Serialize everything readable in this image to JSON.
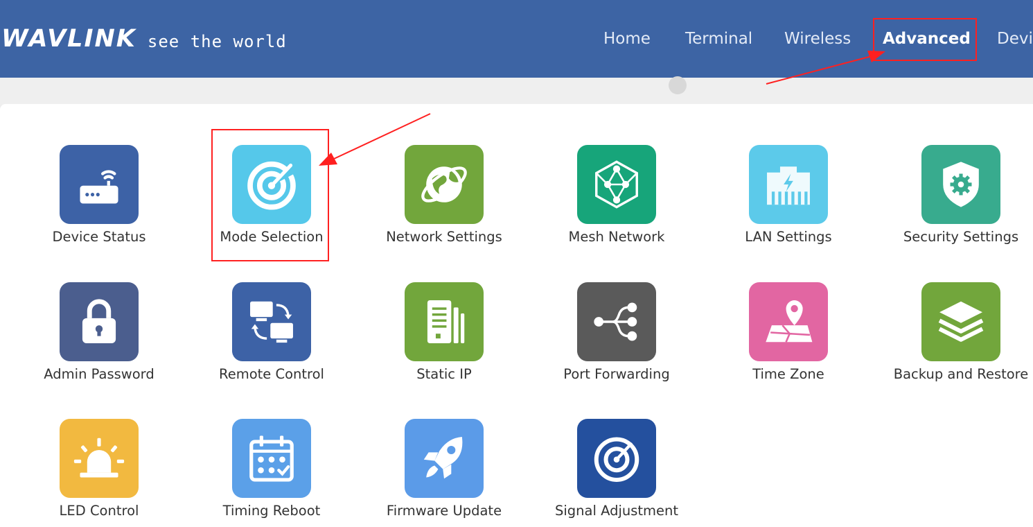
{
  "header": {
    "brand": "WAVLINK",
    "tagline": "see the world",
    "background": "#3d64a4",
    "nav": [
      {
        "label": "Home",
        "active": false
      },
      {
        "label": "Terminal",
        "active": false
      },
      {
        "label": "Wireless",
        "active": false
      },
      {
        "label": "Advanced",
        "active": true
      },
      {
        "label": "Devic",
        "active": false
      }
    ]
  },
  "annotation_color": "#ff2020",
  "tiles": [
    {
      "label": "Device Status",
      "icon": "router-wifi-icon",
      "color": "#3d62a6"
    },
    {
      "label": "Mode Selection",
      "icon": "radar-icon",
      "color": "#55c8ea"
    },
    {
      "label": "Network Settings",
      "icon": "globe-orbit-icon",
      "color": "#72a63c"
    },
    {
      "label": "Mesh Network",
      "icon": "mesh-hexagon-icon",
      "color": "#17a57a"
    },
    {
      "label": "LAN Settings",
      "icon": "ethernet-port-icon",
      "color": "#5ccaea"
    },
    {
      "label": "Security Settings",
      "icon": "shield-gear-icon",
      "color": "#38ab8e"
    },
    {
      "label": "Admin Password",
      "icon": "padlock-icon",
      "color": "#4b5e8e"
    },
    {
      "label": "Remote Control",
      "icon": "remote-screens-icon",
      "color": "#3d62a6"
    },
    {
      "label": "Static IP",
      "icon": "document-stack-icon",
      "color": "#72a63c"
    },
    {
      "label": "Port Forwarding",
      "icon": "share-nodes-icon",
      "color": "#5a5a5a"
    },
    {
      "label": "Time Zone",
      "icon": "map-pin-icon",
      "color": "#e266a2"
    },
    {
      "label": "Backup and Restore",
      "icon": "layers-icon",
      "color": "#72a63c"
    },
    {
      "label": "LED Control",
      "icon": "alarm-light-icon",
      "color": "#f2b940"
    },
    {
      "label": "Timing Reboot",
      "icon": "calendar-check-icon",
      "color": "#5ba0e8"
    },
    {
      "label": "Firmware Update",
      "icon": "rocket-icon",
      "color": "#5b9be8"
    },
    {
      "label": "Signal Adjustment",
      "icon": "signal-gauge-icon",
      "color": "#24509e"
    }
  ]
}
